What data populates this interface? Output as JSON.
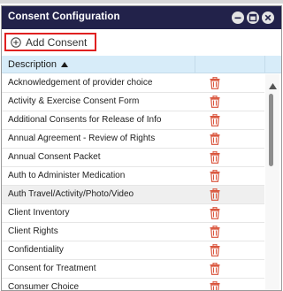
{
  "window": {
    "title": "Consent Configuration",
    "controls": [
      "minimize-icon",
      "maximize-icon",
      "close-icon"
    ]
  },
  "toolbar": {
    "add_label": "Add Consent",
    "add_icon": "plus-circle-icon"
  },
  "grid": {
    "columns": [
      {
        "label": "Description",
        "sort": "ascending"
      }
    ],
    "row_action_icon": "trash-icon",
    "rows": [
      {
        "label": "Acknowledgement of provider choice"
      },
      {
        "label": "Activity & Exercise Consent Form"
      },
      {
        "label": "Additional Consents for Release of Info"
      },
      {
        "label": "Annual Agreement - Review of Rights"
      },
      {
        "label": "Annual Consent Packet"
      },
      {
        "label": "Auth to Administer Medication"
      },
      {
        "label": "Auth Travel/Activity/Photo/Video"
      },
      {
        "label": "Client Inventory"
      },
      {
        "label": "Client Rights"
      },
      {
        "label": "Confidentiality"
      },
      {
        "label": "Consent for Treatment"
      },
      {
        "label": "Consumer Choice"
      }
    ]
  },
  "colors": {
    "titlebar": "#22224a",
    "header": "#d7ecf9",
    "trash": "#d9533b",
    "highlight_border": "#e02020"
  }
}
